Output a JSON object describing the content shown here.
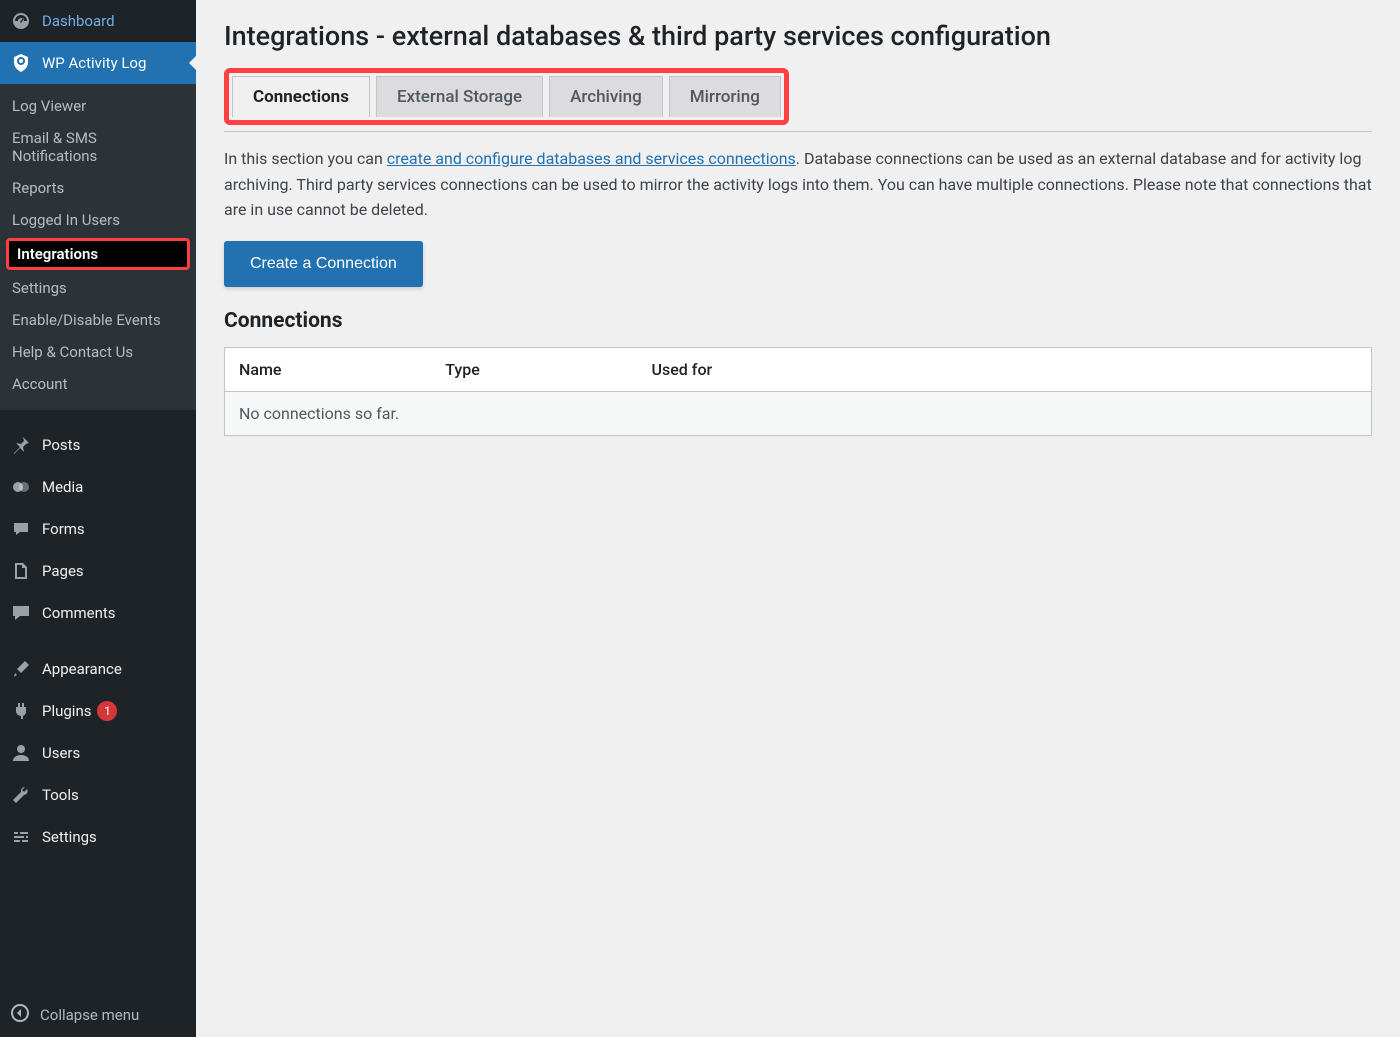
{
  "sidebar": {
    "top_items": [
      {
        "id": "dashboard",
        "label": "Dashboard",
        "icon": "dashboard"
      },
      {
        "id": "wpal",
        "label": "WP Activity Log",
        "icon": "shield",
        "active": true
      }
    ],
    "submenu": [
      {
        "id": "log-viewer",
        "label": "Log Viewer"
      },
      {
        "id": "email-sms",
        "label": "Email & SMS Notifications"
      },
      {
        "id": "reports",
        "label": "Reports"
      },
      {
        "id": "logged-in",
        "label": "Logged In Users"
      },
      {
        "id": "integrations",
        "label": "Integrations",
        "current": true,
        "highlighted": true
      },
      {
        "id": "settings",
        "label": "Settings"
      },
      {
        "id": "enable-disable",
        "label": "Enable/Disable Events"
      },
      {
        "id": "help",
        "label": "Help & Contact Us"
      },
      {
        "id": "account",
        "label": "Account"
      }
    ],
    "main_items": [
      {
        "id": "posts",
        "label": "Posts",
        "icon": "pin"
      },
      {
        "id": "media",
        "label": "Media",
        "icon": "media"
      },
      {
        "id": "forms",
        "label": "Forms",
        "icon": "chat"
      },
      {
        "id": "pages",
        "label": "Pages",
        "icon": "page"
      },
      {
        "id": "comments",
        "label": "Comments",
        "icon": "comment"
      }
    ],
    "admin_items": [
      {
        "id": "appearance",
        "label": "Appearance",
        "icon": "brush"
      },
      {
        "id": "plugins",
        "label": "Plugins",
        "icon": "plug",
        "badge": "1"
      },
      {
        "id": "users",
        "label": "Users",
        "icon": "user"
      },
      {
        "id": "tools",
        "label": "Tools",
        "icon": "wrench"
      },
      {
        "id": "admin-settings",
        "label": "Settings",
        "icon": "sliders"
      }
    ],
    "collapse_label": "Collapse menu"
  },
  "main": {
    "title": "Integrations - external databases & third party services configuration",
    "tabs": [
      {
        "id": "connections",
        "label": "Connections",
        "active": true
      },
      {
        "id": "external-storage",
        "label": "External Storage"
      },
      {
        "id": "archiving",
        "label": "Archiving"
      },
      {
        "id": "mirroring",
        "label": "Mirroring"
      }
    ],
    "desc_prefix": "In this section you can ",
    "desc_link": "create and configure databases and services connections",
    "desc_suffix": ". Database connections can be used as an external database and for activity log archiving. Third party services connections can be used to mirror the activity logs into them. You can have multiple connections. Please note that connections that are in use cannot be deleted.",
    "create_btn": "Create a Connection",
    "section_heading": "Connections",
    "table": {
      "columns": [
        "Name",
        "Type",
        "Used for"
      ],
      "empty": "No connections so far."
    }
  }
}
